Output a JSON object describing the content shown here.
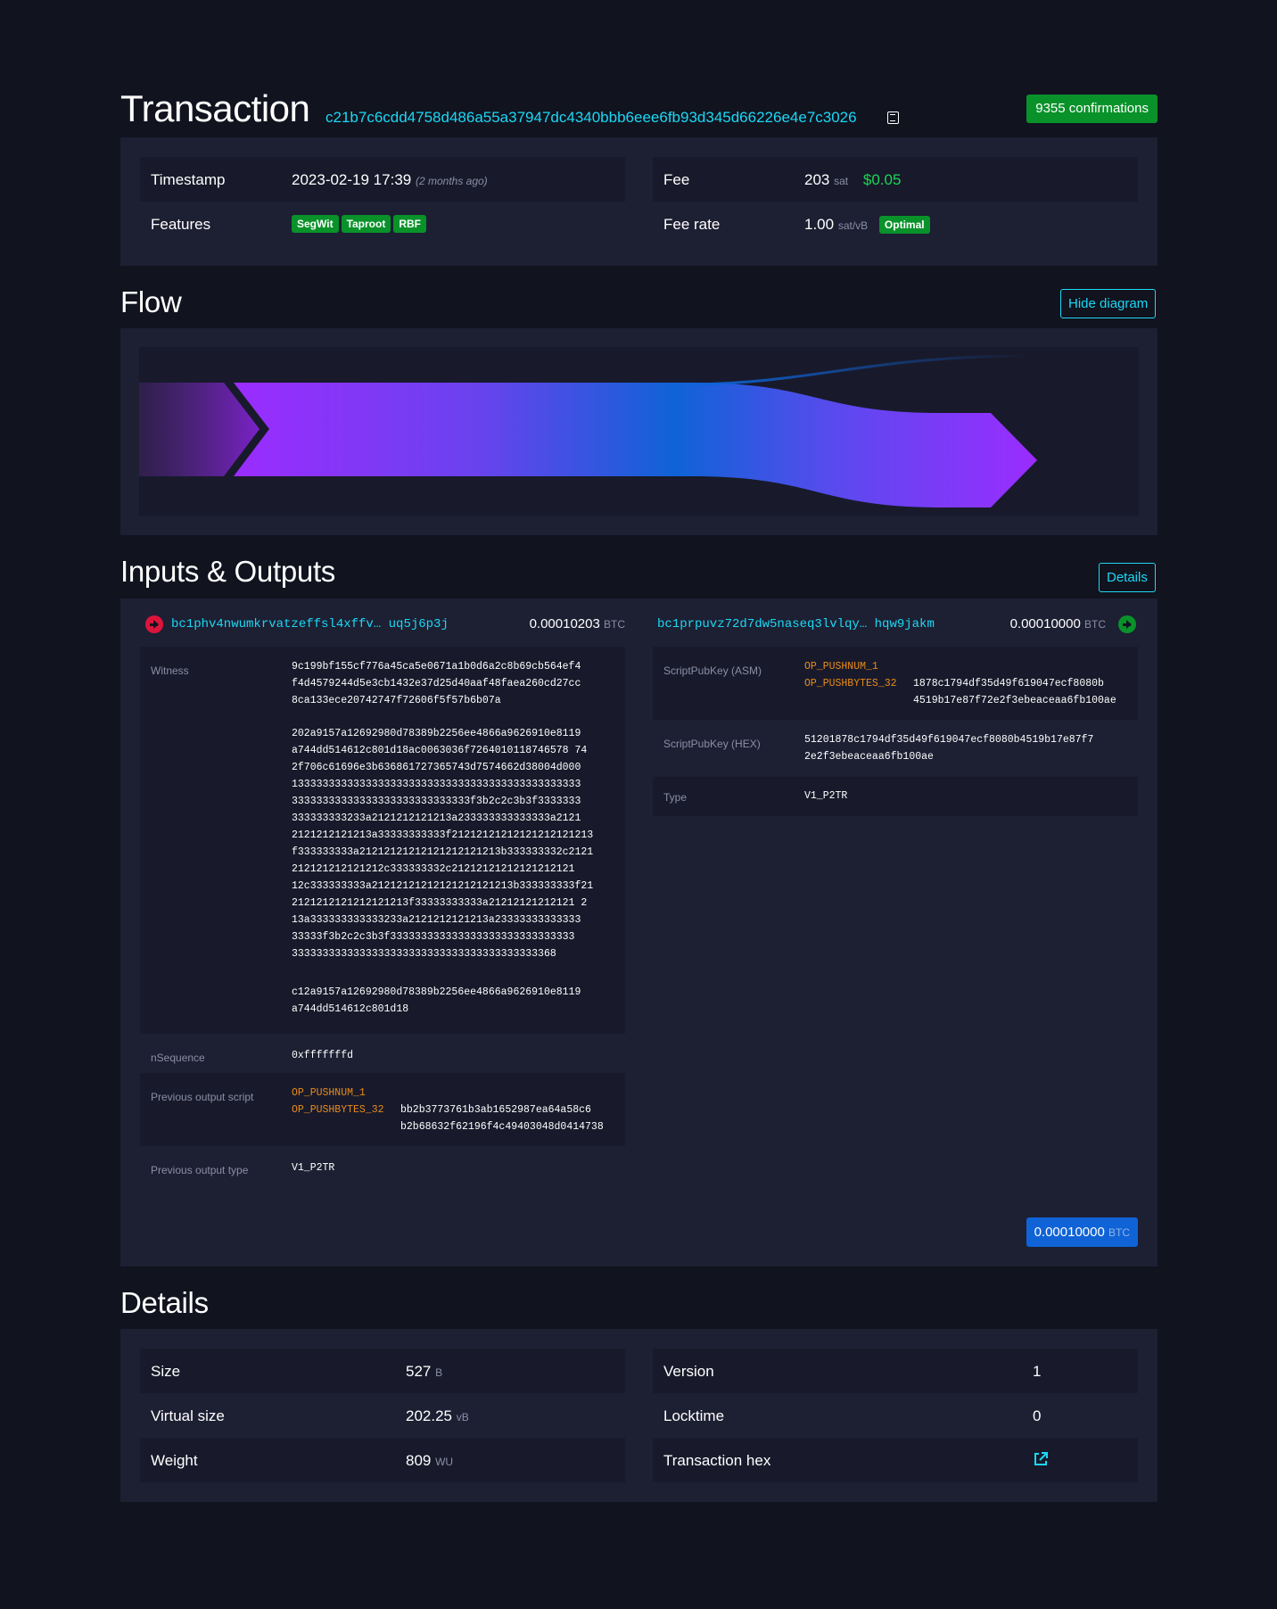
{
  "header": {
    "title": "Transaction",
    "txid": "c21b7c6cdd4758d486a55a37947dc4340bbb6eee6fb93d345d66226e4e7c3026",
    "confirmations": "9355 confirmations"
  },
  "summary": {
    "timestamp_label": "Timestamp",
    "timestamp_value": "2023-02-19 17:39",
    "timestamp_ago": "(2 months ago)",
    "features_label": "Features",
    "features": [
      "SegWit",
      "Taproot",
      "RBF"
    ],
    "fee_label": "Fee",
    "fee_value": "203",
    "fee_unit": "sat",
    "fee_fiat": "$0.05",
    "feerate_label": "Fee rate",
    "feerate_value": "1.00",
    "feerate_unit": "sat/vB",
    "feerate_badge": "Optimal"
  },
  "flow": {
    "title": "Flow",
    "toggle_label": "Hide diagram"
  },
  "io": {
    "title": "Inputs & Outputs",
    "details_button": "Details",
    "input": {
      "address": "bc1phv4nwumkrvatzeffsl4xffv… uq5j6p3j",
      "amount": "0.00010203",
      "unit": "BTC",
      "witness_label": "Witness",
      "witness": [
        "9c199bf155cf776a45ca5e0671a1b0d6a2c8b69cb564ef4\nf4d4579244d5e3cb1432e37d25d40aaf48faea260cd27cc\n8ca133ece20742747f72606f5f57b6b07a",
        "202a9157a12692980d78389b2256ee4866a9626910e8119\na744dd514612c801d18ac0063036f7264010118746578 74\n2f706c61696e3b636861727365743d7574662d38004d000\n13333333333333333333333333333333333333333333333\n33333333333333333333333333333f3b2c2c3b3f3333333\n333333333233a2121212121213a233333333333333a2121\n2121212121213a33333333333f21212121212121212121213\nf333333333a21212121212121212121213b333333332c2121\n212121212121212c333333332c21212121212121212121\n12c333333333a21212121212121212121213b333333333f21\n2121212121212121213f33333333333a21212121212121 2\n13a333333333333233a2121212121213a23333333333333\n33333f3b2c2c3b3f333333333333333333333333333333\n3333333333333333333333333333333333333333368",
        "c12a9157a12692980d78389b2256ee4866a9626910e8119\na744dd514612c801d18"
      ],
      "nsequence_label": "nSequence",
      "nsequence": "0xfffffffd",
      "prev_script_label": "Previous output script",
      "prev_script_op1": "OP_PUSHNUM_1",
      "prev_script_op2": "OP_PUSHBYTES_32",
      "prev_script_data": "bb2b3773761b3ab1652987ea64a58c6\nb2b68632f62196f4c49403048d0414738",
      "prev_type_label": "Previous output type",
      "prev_type": "V1_P2TR"
    },
    "output": {
      "address": "bc1prpuvz72d7dw5naseq3lvlqy… hqw9jakm",
      "amount": "0.00010000",
      "unit": "BTC",
      "asm_label": "ScriptPubKey (ASM)",
      "asm_op1": "OP_PUSHNUM_1",
      "asm_op2": "OP_PUSHBYTES_32",
      "asm_data": "1878c1794df35d49f619047ecf8080b\n4519b17e87f72e2f3ebeaceaa6fb100ae",
      "hex_label": "ScriptPubKey (HEX)",
      "hex": "51201878c1794df35d49f619047ecf8080b4519b17e87f7\n2e2f3ebeaceaa6fb100ae",
      "type_label": "Type",
      "type": "V1_P2TR"
    },
    "total_amount": "0.00010000",
    "total_unit": "BTC"
  },
  "details": {
    "title": "Details",
    "size_label": "Size",
    "size_value": "527",
    "size_unit": "B",
    "vsize_label": "Virtual size",
    "vsize_value": "202.25",
    "vsize_unit": "vB",
    "weight_label": "Weight",
    "weight_value": "809",
    "weight_unit": "WU",
    "version_label": "Version",
    "version_value": "1",
    "locktime_label": "Locktime",
    "locktime_value": "0",
    "hex_label": "Transaction hex"
  },
  "colors": {
    "accent": "#1bd8f4",
    "green": "#09922a",
    "red": "#dc143c",
    "orange": "#e88a1a",
    "flow_purple": "#9b2cff",
    "flow_blue": "#0f63d6"
  }
}
